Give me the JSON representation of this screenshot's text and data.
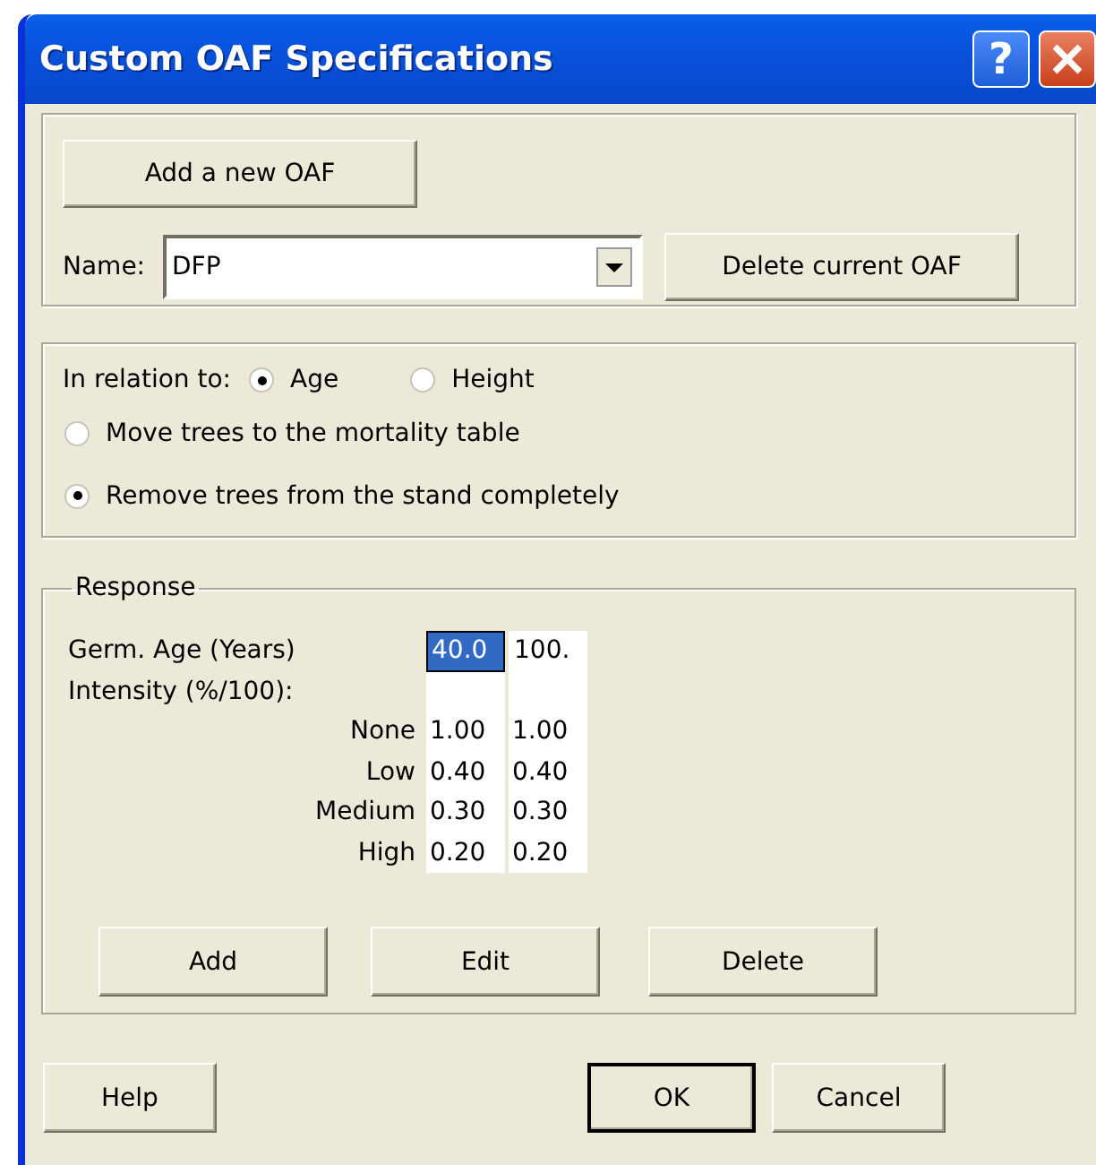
{
  "window": {
    "title": "Custom OAF Specifications",
    "help_glyph": "?"
  },
  "add_button": "Add a new OAF",
  "name_field": {
    "label": "Name:",
    "value": "DFP"
  },
  "delete_button": "Delete current OAF",
  "relation": {
    "label": "In relation to:",
    "options": [
      {
        "label": "Age",
        "selected": true
      },
      {
        "label": "Height",
        "selected": false
      }
    ]
  },
  "actions": [
    {
      "label": "Move trees to the mortality table",
      "selected": false
    },
    {
      "label": "Remove trees from the stand completely",
      "selected": true
    }
  ],
  "response": {
    "title": "Response",
    "age_label": "Germ. Age (Years)",
    "intensity_label": "Intensity (%/100):",
    "levels": [
      "None",
      "Low",
      "Medium",
      "High"
    ],
    "columns": [
      {
        "age": "40.0",
        "selected": true,
        "values": [
          "1.00",
          "0.40",
          "0.30",
          "0.20"
        ]
      },
      {
        "age": "100.",
        "selected": false,
        "values": [
          "1.00",
          "0.40",
          "0.30",
          "0.20"
        ]
      }
    ],
    "buttons": [
      "Add",
      "Edit",
      "Delete"
    ]
  },
  "footer": [
    {
      "label": "Help",
      "default": false
    },
    {
      "label": "OK",
      "default": true
    },
    {
      "label": "Cancel",
      "default": false
    }
  ]
}
